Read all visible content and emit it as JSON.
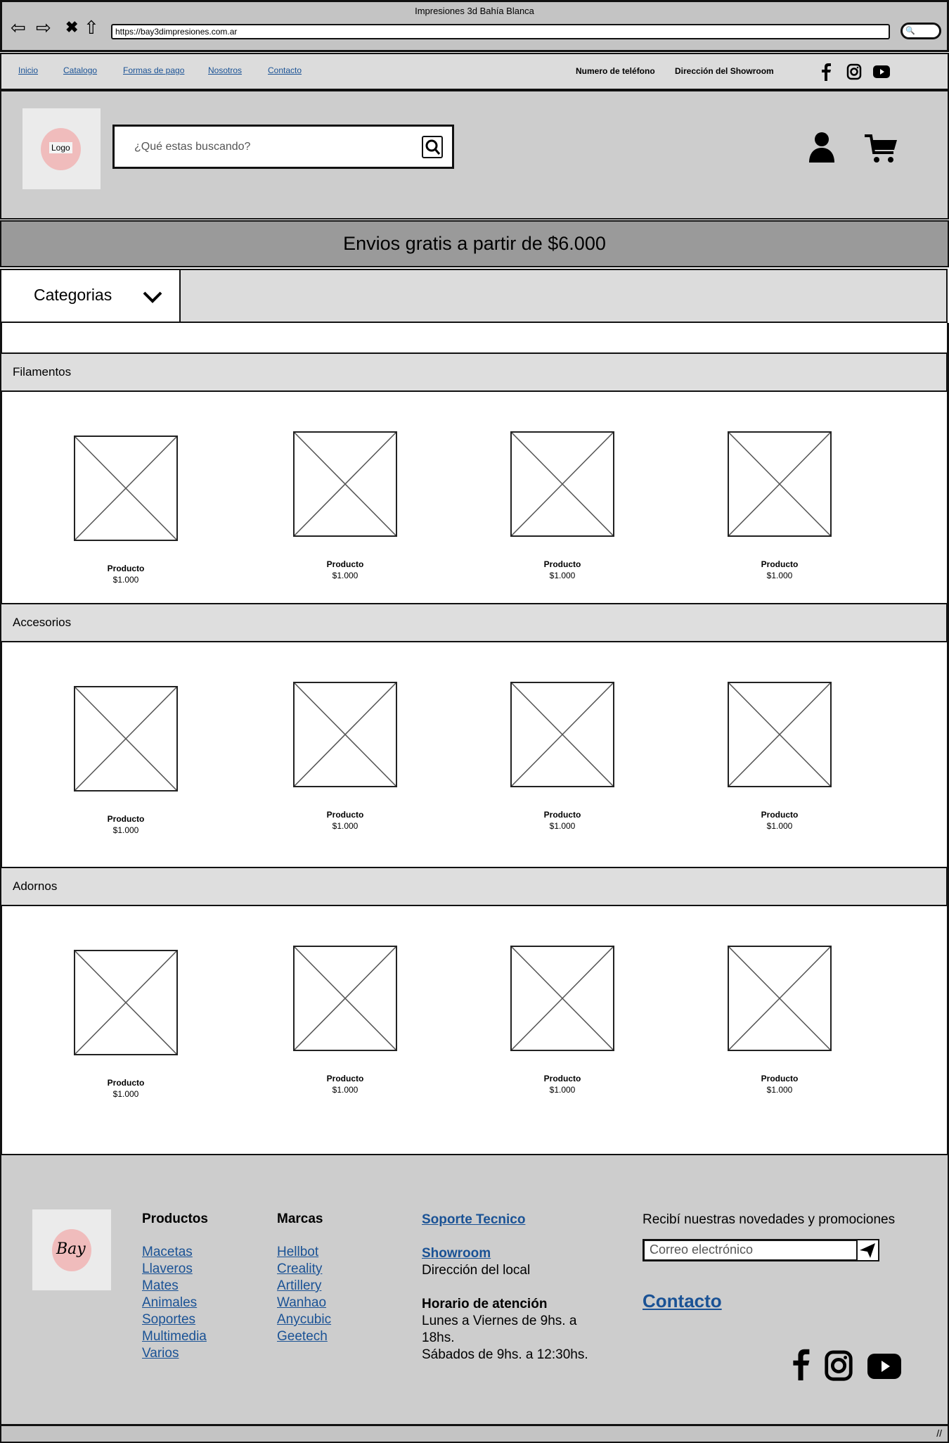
{
  "browser": {
    "title": "Impresiones 3d Bahía Blanca",
    "url": "https://bay3dimpresiones.com.ar"
  },
  "nav": {
    "links": [
      "Inicio",
      "Catalogo",
      "Formas de pago",
      "Nosotros",
      "Contacto"
    ],
    "phone": "Numero de teléfono",
    "address": "Dirección del Showroom"
  },
  "header": {
    "logo": "Logo",
    "search_placeholder": "¿Qué estas buscando?"
  },
  "banner": "Envios gratis a partir de $6.000",
  "categories_label": "Categorias",
  "sections": [
    {
      "title": "Filamentos",
      "products": [
        {
          "name": "Producto",
          "price": "$1.000"
        },
        {
          "name": "Producto",
          "price": "$1.000"
        },
        {
          "name": "Producto",
          "price": "$1.000"
        },
        {
          "name": "Producto",
          "price": "$1.000"
        }
      ]
    },
    {
      "title": "Accesorios",
      "products": [
        {
          "name": "Producto",
          "price": "$1.000"
        },
        {
          "name": "Producto",
          "price": "$1.000"
        },
        {
          "name": "Producto",
          "price": "$1.000"
        },
        {
          "name": "Producto",
          "price": "$1.000"
        }
      ]
    },
    {
      "title": "Adornos",
      "products": [
        {
          "name": "Producto",
          "price": "$1.000"
        },
        {
          "name": "Producto",
          "price": "$1.000"
        },
        {
          "name": "Producto",
          "price": "$1.000"
        },
        {
          "name": "Producto",
          "price": "$1.000"
        }
      ]
    }
  ],
  "footer": {
    "logo": "Bay",
    "productos_title": "Productos",
    "productos": [
      "Macetas",
      "Llaveros",
      "Mates",
      "Animales",
      "Soportes",
      "Multimedia",
      "Varios"
    ],
    "marcas_title": "Marcas",
    "marcas": [
      "Hellbot",
      "Creality",
      "Artillery",
      "Wanhao",
      "Anycubic",
      "Geetech"
    ],
    "soporte": "Soporte Tecnico",
    "showroom": "Showroom",
    "showroom_address": "Dirección del local",
    "horario_title": "Horario de atención",
    "horario": [
      "Lunes a Viernes de 9hs. a",
      "18hs.",
      "Sábados de 9hs. a 12:30hs."
    ],
    "newsletter": "Recibí nuestras novedades y promociones",
    "email_placeholder": "Correo electrónico",
    "contacto": "Contacto"
  }
}
